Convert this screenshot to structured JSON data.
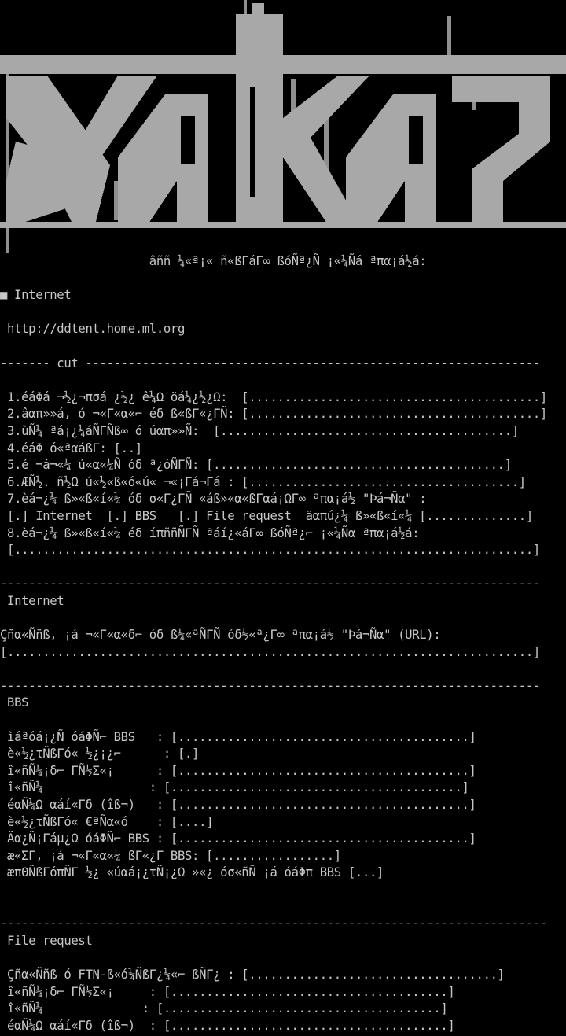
{
  "logo": {
    "lettering": "XaKa?",
    "colors": {
      "fill": "#a8a8a8",
      "background": "#000000"
    }
  },
  "lines": [
    "                     âññ ¼«ª¡« ñ«ßΓáΓ∞ ßóÑª¿Ñ ¡«¼Ñá ªπα¡á½á:",
    "",
    "■ Internet",
    "",
    " http://ddtent.home.ml.org",
    "",
    "------- cut ----------------------------------------------------------------",
    "",
    " 1.éáΦá ¬½¿¬πσá ¿½¿ ê¼Ω öá¼¿½¿Ω:  [.........................................]",
    " 2.âαπ»»á, ó ¬«Γ«α«⌐ éδ ß«ßΓ«¿ΓÑ: [.........................................]",
    " 3.ùÑ¼ ªá¡¿¼áÑΓÑß∞ ó úαπ»»Ñ:  [.........................................]",
    " 4.éáΦ ó«ªαáßΓ: [..]",
    " 5.é ¬á¬«¼ ú«α«¼Ñ óδ ª¿óÑΓÑ: [.........................................]",
    " 6.ÆÑ½. ñ½Ω ú«½«ß«ó«ú« ¬«¡Γá¬Γá : [......................................]",
    " 7.èá¬¿¼ ß»«ß«í«¼ óδ σ«Γ¿ΓÑ «áß»«α«ßΓαá¡ΩΓ∞ ªπα¡á½ \"Þá¬Ñα\" :",
    " [.] Internet  [.] BBS   [.] File request  äαπú¿¼ ß»«ß«í«¼ [..............]",
    " 8.èá¬¿¼ ß»«ß«í«¼ éδ íπññÑΓÑ ªáí¿«áΓ∞ ßóÑª¿⌐ ¡«¼Ñα ªπα¡á½á:",
    " [.........................................................................]",
    "",
    "----------------------------------------------------------------------------",
    " Internet",
    "",
    "Çñα«Ññß, ¡á ¬«Γ«α«δ⌐ óδ ß¼«ªÑΓÑ óδ½«ª¿Γ∞ ªπα¡á½ \"Þá¬Ñα\" (URL):",
    "[..........................................................................]",
    "",
    "----------------------------------------------------------------------------",
    " BBS",
    "",
    " ìáªóá¡¿Ñ óáΦÑ⌐ BBS   : [.........................................]",
    " è«½¿τÑßΓó« ½¿¡¿⌐      : [.]",
    " î«ñÑ¼¡δ⌐ ΓÑ½Σ«¡      : [.........................................]",
    " î«ñÑ¼               : [.........................................]",
    " éαÑ¼Ω αáí«Γδ (îß¬)   : [.........................................]",
    " è«½¿τÑßΓó« €ªÑα«ó    : [....]",
    " Äα¿Ñ¡Γáµ¿Ω óáΦÑ⌐ BBS : [.........................................]",
    " æ«ΣΓ, ¡á ¬«Γ«α«¼ ßΓ«¿Γ BBS: [.................]",
    " æπΘÑßΓóπÑΓ ½¿ «úαá¡¿τÑ¡¿Ω »«¿ óσ«ñÑ ¡á óáΦπ BBS [...]",
    "",
    "",
    "-----------------------------------------------------------------------------",
    " File request",
    "",
    " Çñα«Ññß ó FTN-ß«ó¼ÑßΓ¿¼«⌐ ßÑΓ¿ : [...................................]",
    " î«ñÑ¼¡δ⌐ ΓÑ½Σ«¡     : [.......................................]",
    " î«ñÑ¼              : [.......................................]",
    " éαÑ¼Ω αáí«Γδ (îß¬)  : [.......................................]",
    "-----------------------------------------------------------------------------"
  ]
}
